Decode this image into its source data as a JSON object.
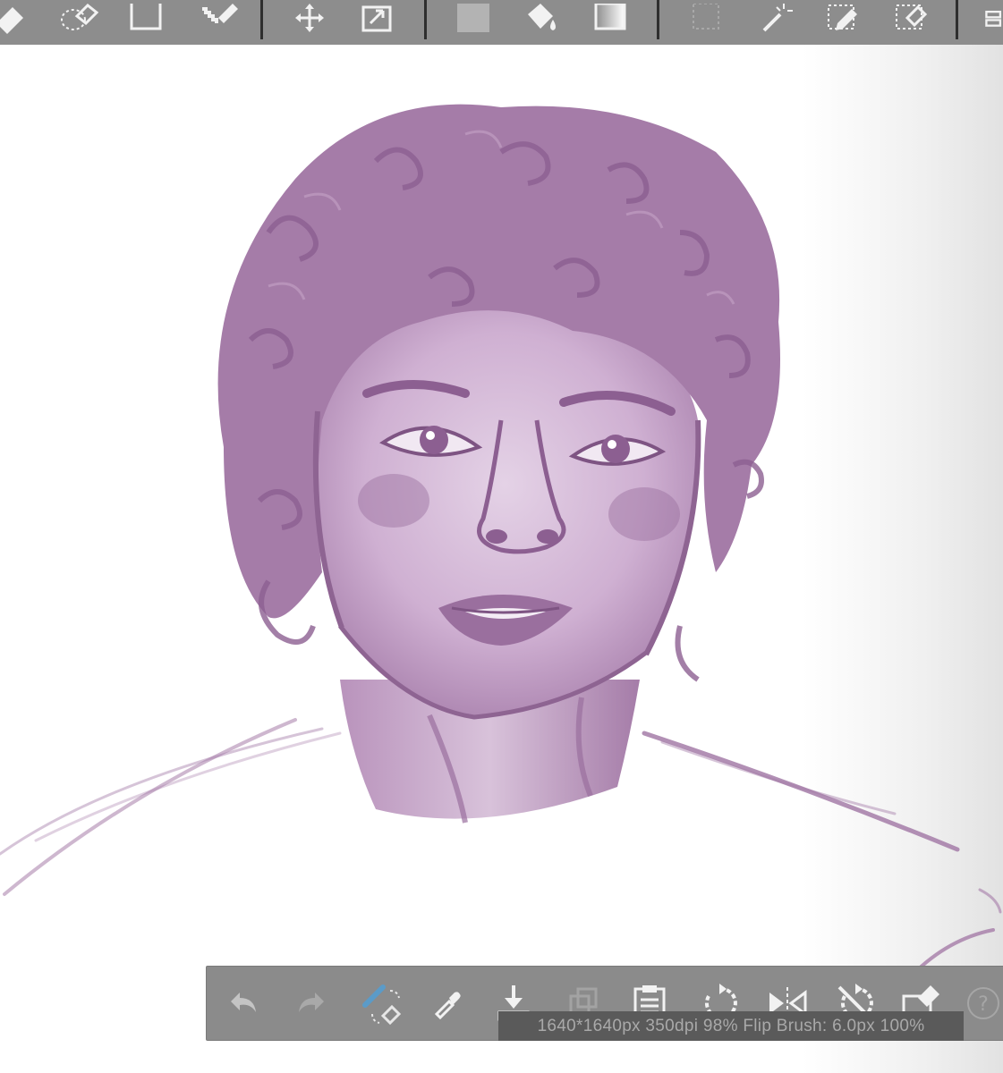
{
  "app": {
    "accent_color": "#5b9bc8",
    "toolbar_color": "#8d8d8d",
    "icon_color": "#f2f2f2"
  },
  "top_toolbar": {
    "items": [
      {
        "icon": "eraser-icon"
      },
      {
        "icon": "selection-eraser-icon"
      },
      {
        "icon": "blank-layer-icon"
      },
      {
        "icon": "pixel-brush-icon"
      },
      {
        "icon": "move-icon"
      },
      {
        "icon": "transform-icon"
      },
      {
        "icon": "color-swatch-icon"
      },
      {
        "icon": "fill-bucket-icon"
      },
      {
        "icon": "gradient-icon"
      },
      {
        "icon": "rect-select-icon"
      },
      {
        "icon": "magic-wand-icon"
      },
      {
        "icon": "select-pen-icon"
      },
      {
        "icon": "select-eraser-icon"
      },
      {
        "icon": "layers-icon"
      }
    ]
  },
  "canvas": {
    "ink_color": "#a57ca8",
    "subject": "digital painting"
  },
  "bottom_toolbar": {
    "items": [
      {
        "icon": "undo-icon"
      },
      {
        "icon": "redo-icon"
      },
      {
        "icon": "brush-eraser-toggle-icon"
      },
      {
        "icon": "eyedropper-icon"
      },
      {
        "icon": "save-download-icon"
      },
      {
        "icon": "copy-layer-icon"
      },
      {
        "icon": "paste-icon"
      },
      {
        "icon": "rotate-icon"
      },
      {
        "icon": "flip-icon"
      },
      {
        "icon": "reset-rotation-icon"
      },
      {
        "icon": "clear-icon"
      },
      {
        "icon": "help-icon"
      }
    ],
    "status_text": "1640*1640px 350dpi 98% Flip Brush: 6.0px 100%"
  }
}
